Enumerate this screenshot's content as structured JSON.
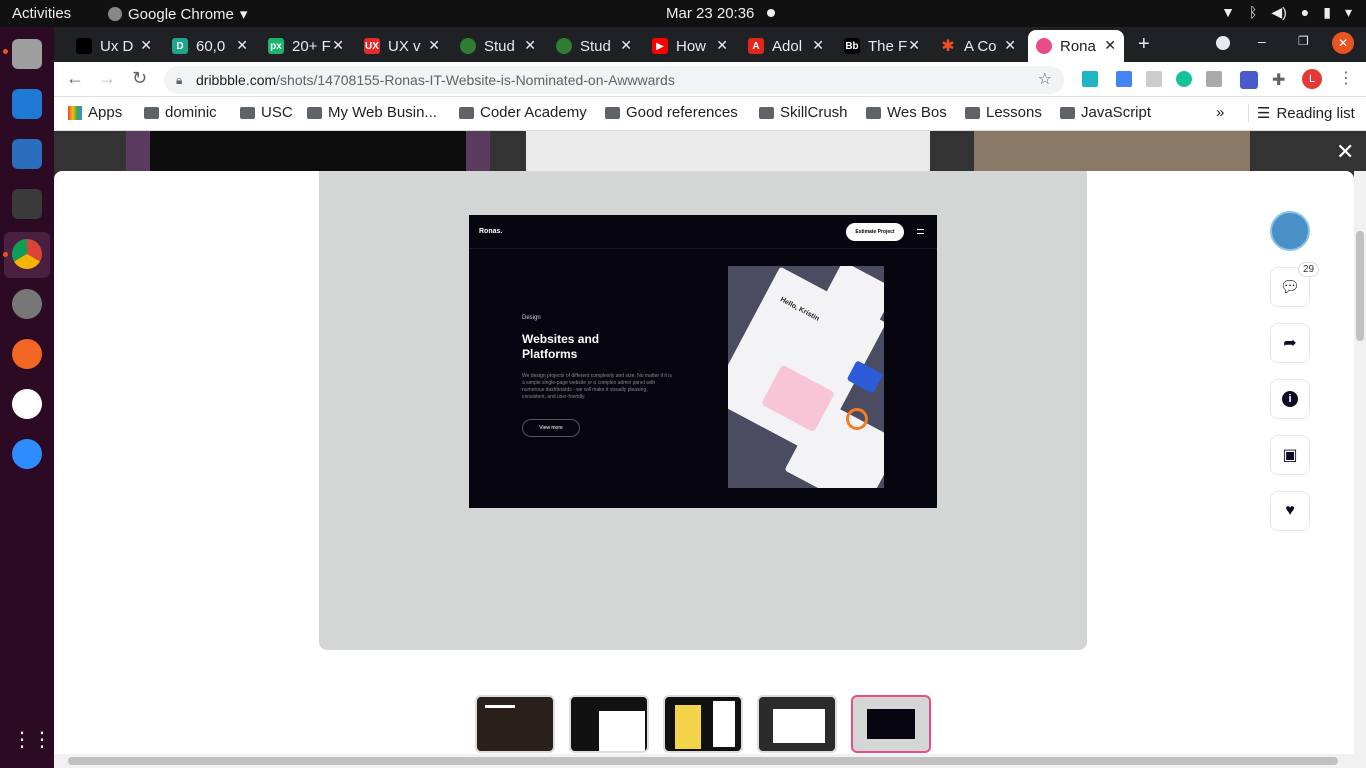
{
  "system": {
    "activities": "Activities",
    "app_name": "Google Chrome",
    "clock": "Mar 23  20:36"
  },
  "tabs": [
    {
      "title": "Ux D",
      "fav_text": "",
      "fav_color": "#000000"
    },
    {
      "title": "60,0",
      "fav_text": "D",
      "fav_color": "#1fa589"
    },
    {
      "title": "20+ F",
      "fav_text": "px",
      "fav_color": "#1cb36b"
    },
    {
      "title": "UX v",
      "fav_text": "UX",
      "fav_color": "#e52a2a"
    },
    {
      "title": "Stud",
      "fav_text": "",
      "fav_color": "#2e7d32"
    },
    {
      "title": "Stud",
      "fav_text": "",
      "fav_color": "#2e7d32"
    },
    {
      "title": "How",
      "fav_text": "▶",
      "fav_color": "#ff0000"
    },
    {
      "title": "Adol",
      "fav_text": "A",
      "fav_color": "#e1251b"
    },
    {
      "title": "The F",
      "fav_text": "Bb",
      "fav_color": "#000000"
    },
    {
      "title": "A Co",
      "fav_text": "✱",
      "fav_color": "#f04e23"
    },
    {
      "title": "Rona",
      "fav_text": "",
      "fav_color": "#ea4c89"
    }
  ],
  "toolbar": {
    "url_domain": "dribbble.com",
    "url_path": "/shots/14708155-Ronas-IT-Website-is-Nominated-on-Awwwards"
  },
  "bookmarks": {
    "apps": "Apps",
    "items": [
      "dominic",
      "USC",
      "My Web Busin...",
      "Coder Academy",
      "Good references",
      "SkillCrush",
      "Wes Bos",
      "Lessons",
      "JavaScript"
    ],
    "more": "»",
    "reading_list": "Reading list"
  },
  "shot": {
    "logo": "Ronas.",
    "estimate_button": "Estimate Project",
    "kicker": "Design",
    "heading": "Websites and Platforms",
    "paragraph": "We design projects of different complexity and size. No matter if it is a simple single-page website or a complex admin panel with numerous dashboards - we will make it visually pleasing, consistent, and user-friendly.",
    "view_more": "View more",
    "mock_greeting": "Hello, Kristin"
  },
  "sidebar": {
    "comment_count": "29"
  },
  "colors": {
    "accent": "#ea4c89",
    "stage": "#d4d6d5",
    "ubuntu_dock": "#2d0a24"
  }
}
